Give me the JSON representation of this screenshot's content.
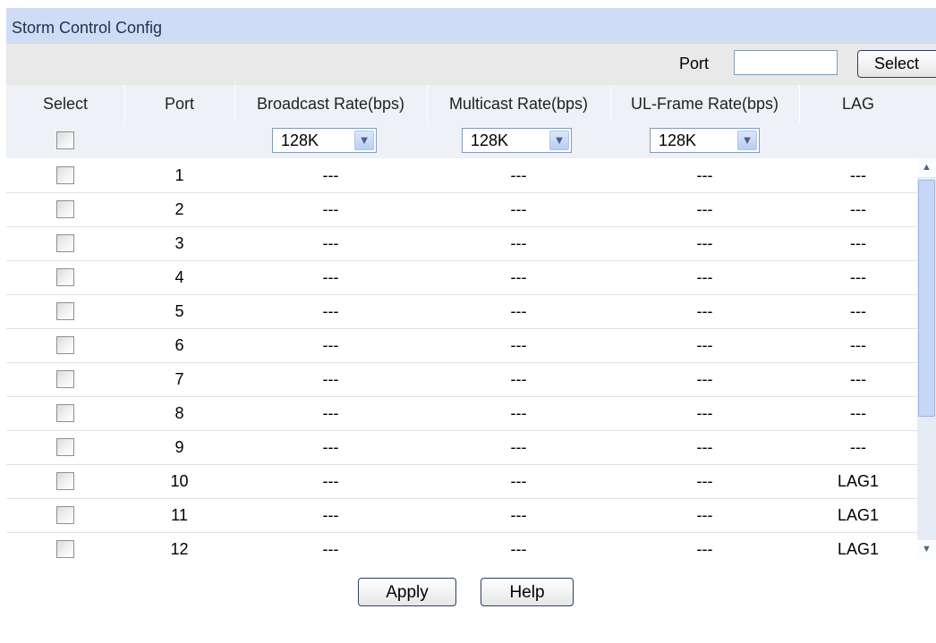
{
  "panel": {
    "title": "Storm Control Config"
  },
  "port_search": {
    "label": "Port",
    "value": "",
    "button_label": "Select"
  },
  "columns": [
    "Select",
    "Port",
    "Broadcast Rate(bps)",
    "Multicast Rate(bps)",
    "UL-Frame Rate(bps)",
    "LAG"
  ],
  "filters": {
    "broadcast": "128K",
    "multicast": "128K",
    "ul_frame": "128K"
  },
  "rows": [
    {
      "port": "1",
      "broadcast": "---",
      "multicast": "---",
      "ul_frame": "---",
      "lag": "---"
    },
    {
      "port": "2",
      "broadcast": "---",
      "multicast": "---",
      "ul_frame": "---",
      "lag": "---"
    },
    {
      "port": "3",
      "broadcast": "---",
      "multicast": "---",
      "ul_frame": "---",
      "lag": "---"
    },
    {
      "port": "4",
      "broadcast": "---",
      "multicast": "---",
      "ul_frame": "---",
      "lag": "---"
    },
    {
      "port": "5",
      "broadcast": "---",
      "multicast": "---",
      "ul_frame": "---",
      "lag": "---"
    },
    {
      "port": "6",
      "broadcast": "---",
      "multicast": "---",
      "ul_frame": "---",
      "lag": "---"
    },
    {
      "port": "7",
      "broadcast": "---",
      "multicast": "---",
      "ul_frame": "---",
      "lag": "---"
    },
    {
      "port": "8",
      "broadcast": "---",
      "multicast": "---",
      "ul_frame": "---",
      "lag": "---"
    },
    {
      "port": "9",
      "broadcast": "---",
      "multicast": "---",
      "ul_frame": "---",
      "lag": "---"
    },
    {
      "port": "10",
      "broadcast": "---",
      "multicast": "---",
      "ul_frame": "---",
      "lag": "LAG1"
    },
    {
      "port": "11",
      "broadcast": "---",
      "multicast": "---",
      "ul_frame": "---",
      "lag": "LAG1"
    },
    {
      "port": "12",
      "broadcast": "---",
      "multicast": "---",
      "ul_frame": "---",
      "lag": "LAG1"
    }
  ],
  "buttons": {
    "apply": "Apply",
    "help": "Help"
  },
  "colors": {
    "title_bg": "#cfdcf6",
    "header_bg": "#eef1f6",
    "search_bg": "#e9e9e9"
  }
}
